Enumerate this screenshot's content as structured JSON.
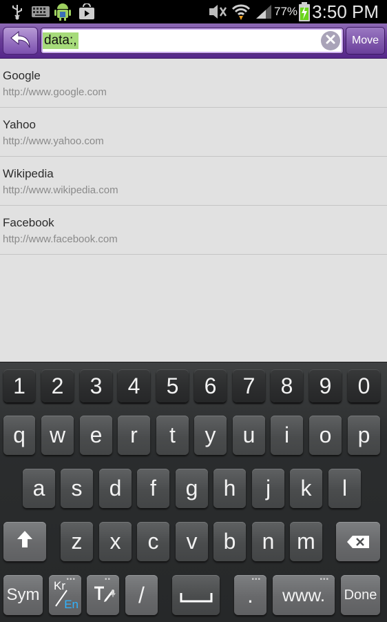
{
  "status": {
    "battery_pct": "77%",
    "time": "3:50 PM",
    "icons": [
      "usb-icon",
      "keyboard-icon",
      "android-icon",
      "play-store-icon",
      "signal-mute-icon",
      "wifi-icon",
      "cell-signal-icon",
      "battery-charging-icon"
    ]
  },
  "addressbar": {
    "url": "data:,",
    "move_label": "Move"
  },
  "suggestions": [
    {
      "title": "Google",
      "url": "http://www.google.com"
    },
    {
      "title": "Yahoo",
      "url": "http://www.yahoo.com"
    },
    {
      "title": "Wikipedia",
      "url": "http://www.wikipedia.com"
    },
    {
      "title": "Facebook",
      "url": "http://www.facebook.com"
    }
  ],
  "keyboard": {
    "numbers": [
      "1",
      "2",
      "3",
      "4",
      "5",
      "6",
      "7",
      "8",
      "9",
      "0"
    ],
    "row1": [
      "q",
      "w",
      "e",
      "r",
      "t",
      "y",
      "u",
      "i",
      "o",
      "p"
    ],
    "row2": [
      "a",
      "s",
      "d",
      "f",
      "g",
      "h",
      "j",
      "k",
      "l"
    ],
    "row3": [
      "z",
      "x",
      "c",
      "v",
      "b",
      "n",
      "m"
    ],
    "sym_label": "Sym",
    "lang_kr": "Kr",
    "lang_en": "En",
    "slash": "/",
    "period": ".",
    "www_label": "www.",
    "done_label": "Done"
  }
}
